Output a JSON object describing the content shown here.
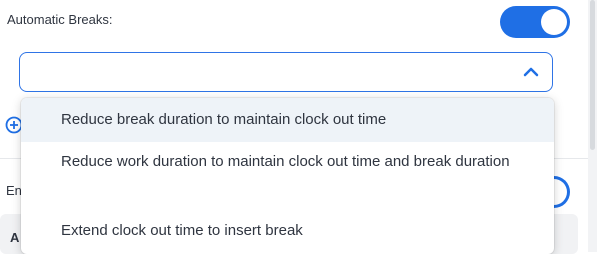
{
  "automatic_breaks": {
    "label": "Automatic Breaks:",
    "toggle_on": true,
    "select_value": "",
    "options": [
      "Reduce break duration to maintain clock out time",
      "Reduce work duration to maintain clock out time and break duration",
      "Extend clock out time to insert break"
    ]
  },
  "next_section": {
    "label_partial": "En",
    "card_label_partial": "A"
  },
  "colors": {
    "accent": "#1f6fe5",
    "highlight": "#eef3f8"
  }
}
